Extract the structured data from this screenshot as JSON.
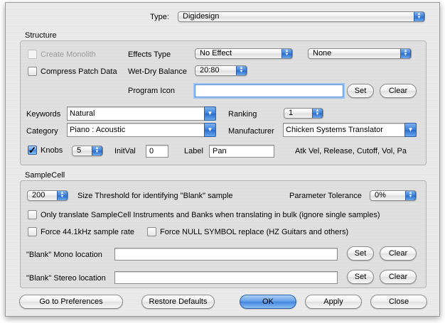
{
  "header": {
    "type_label": "Type:",
    "type_value": "Digidesign"
  },
  "structure": {
    "title": "Structure",
    "create_monolith": "Create Monolith",
    "compress_patch_data": "Compress Patch Data",
    "effects_type_label": "Effects Type",
    "effects_type_value": "No Effect",
    "effects_second_value": "None",
    "wet_dry_label": "Wet-Dry Balance",
    "wet_dry_value": "20:80",
    "program_icon_label": "Program Icon",
    "program_icon_value": "",
    "set_label": "Set",
    "clear_label": "Clear",
    "keywords_label": "Keywords",
    "keywords_value": "Natural",
    "category_label": "Category",
    "category_value": "Piano : Acoustic",
    "ranking_label": "Ranking",
    "ranking_value": "1",
    "manufacturer_label": "Manufacturer",
    "manufacturer_value": "Chicken Systems Translator",
    "knobs_label": "Knobs",
    "knobs_checked": true,
    "knobs_count": "5",
    "initval_label": "InitVal",
    "initval_value": "0",
    "knob_label_label": "Label",
    "knob_label_value": "Pan",
    "knob_list": "Atk Vel, Release, Cutoff, Vol, Pa"
  },
  "samplecell": {
    "title": "SampleCell",
    "threshold_value": "200",
    "threshold_label": "Size Threshold for identifying \"Blank\" sample",
    "tolerance_label": "Parameter Tolerance",
    "tolerance_value": "0%",
    "only_translate": "Only translate SampleCell Instruments and Banks when translating in bulk (ignore single samples)",
    "force_rate": "Force 44.1kHz sample rate",
    "force_null": "Force NULL SYMBOL replace (HZ Guitars and others)",
    "mono_label": "\"Blank\" Mono location",
    "mono_value": "",
    "stereo_label": "\"Blank\" Stereo location",
    "stereo_value": "",
    "set_label": "Set",
    "clear_label": "Clear"
  },
  "footer": {
    "preferences": "Go to Preferences",
    "restore": "Restore Defaults",
    "ok": "OK",
    "apply": "Apply",
    "close": "Close"
  },
  "colors": {
    "accent": "#3f84de",
    "focus_ring": "#9cc3f1"
  }
}
